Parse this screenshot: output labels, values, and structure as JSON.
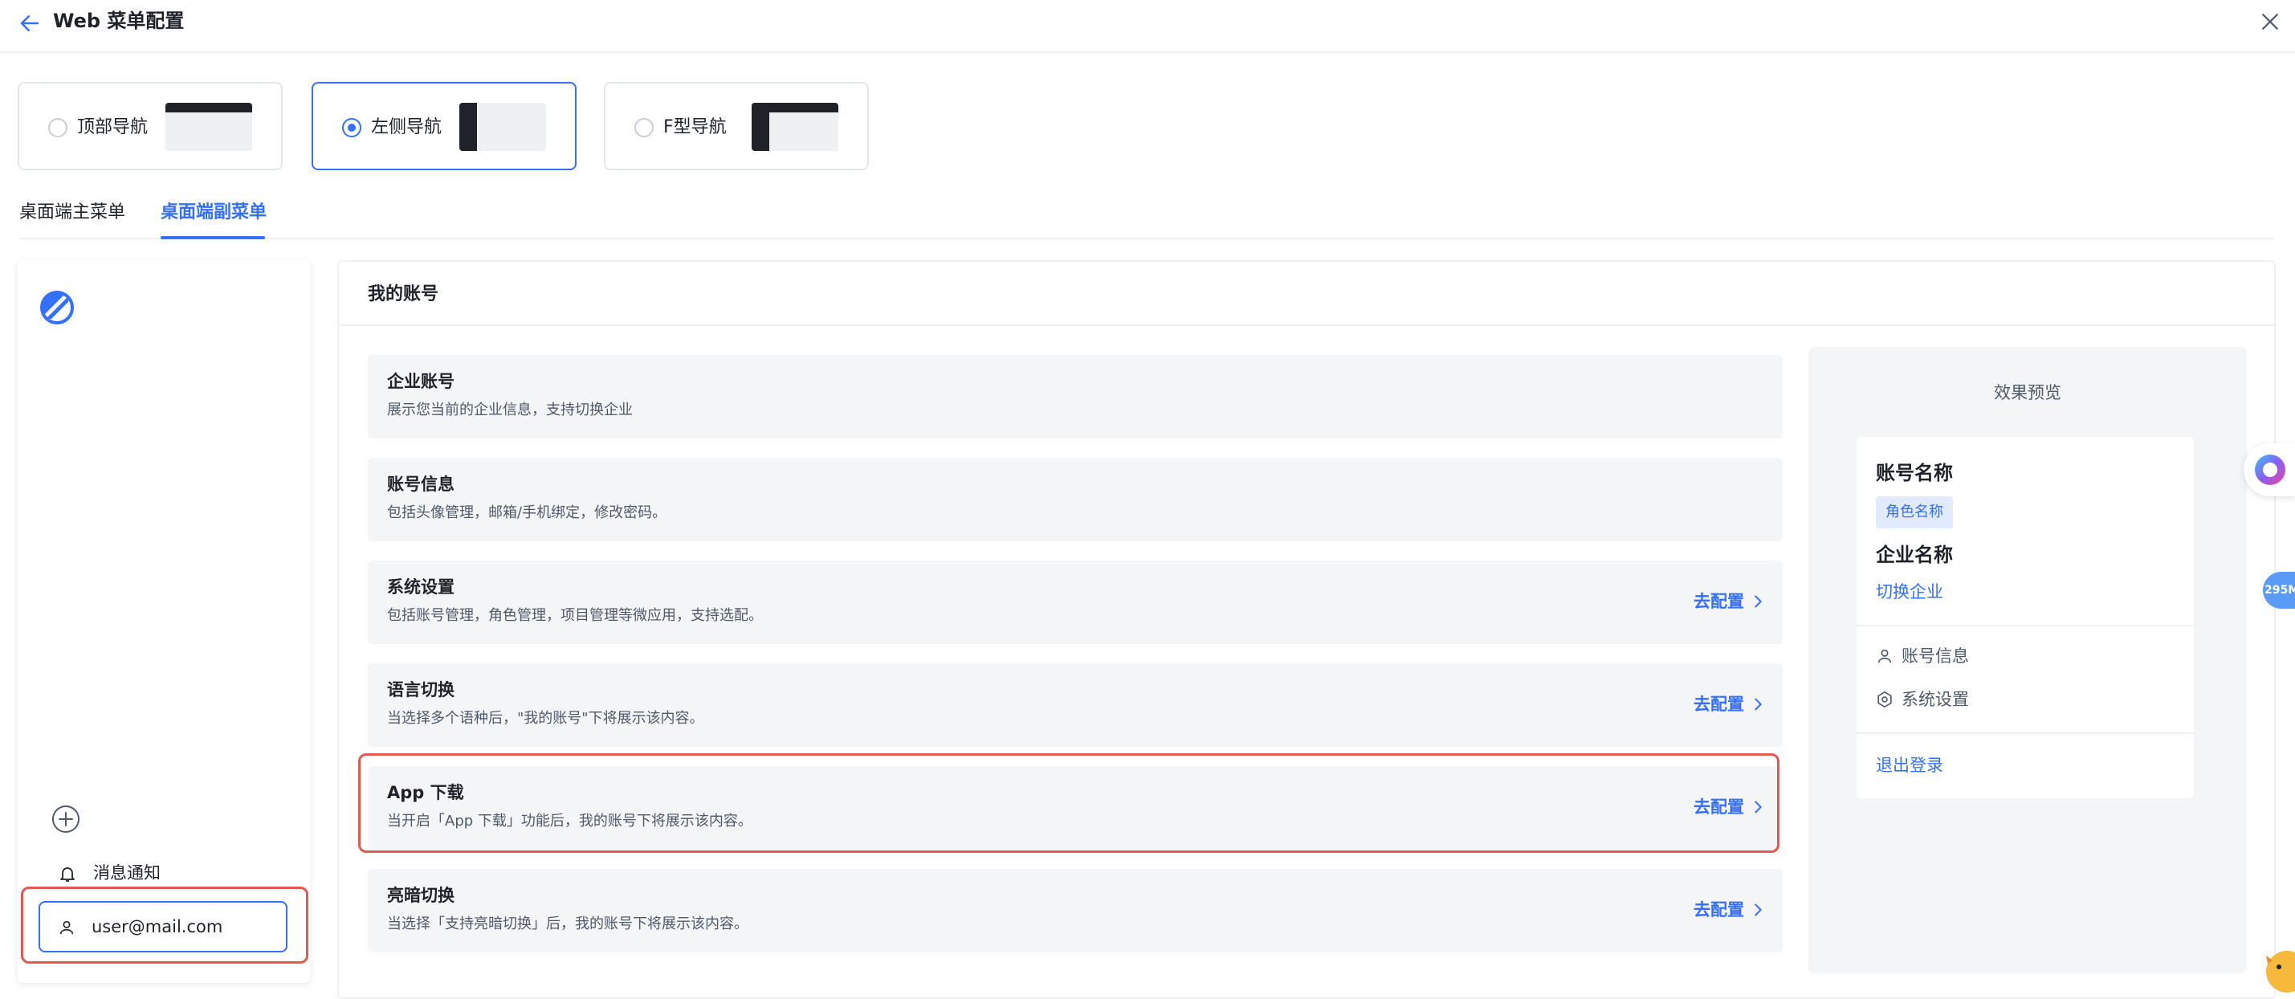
{
  "header": {
    "title": "Web 菜单配置"
  },
  "nav_layouts": [
    {
      "label": "顶部导航",
      "selected": false
    },
    {
      "label": "左侧导航",
      "selected": true
    },
    {
      "label": "F型导航",
      "selected": false
    }
  ],
  "tabs": [
    {
      "label": "桌面端主菜单",
      "active": false
    },
    {
      "label": "桌面端副菜单",
      "active": true
    }
  ],
  "menu_preview": {
    "notification_label": "消息通知",
    "user_label": "user@mail.com"
  },
  "account": {
    "title": "我的账号",
    "cards": [
      {
        "title": "企业账号",
        "desc": "展示您当前的企业信息，支持切换企业",
        "action": ""
      },
      {
        "title": "账号信息",
        "desc": "包括头像管理，邮箱/手机绑定，修改密码。",
        "action": ""
      },
      {
        "title": "系统设置",
        "desc": "包括账号管理，角色管理，项目管理等微应用，支持选配。",
        "action": "去配置"
      },
      {
        "title": "语言切换",
        "desc": "当选择多个语种后，\"我的账号\"下将展示该内容。",
        "action": "去配置"
      },
      {
        "title": "App 下载",
        "desc": "当开启「App 下载」功能后，我的账号下将展示该内容。",
        "action": "去配置"
      },
      {
        "title": "亮暗切换",
        "desc": "当选择「支持亮暗切换」后，我的账号下将展示该内容。",
        "action": "去配置"
      }
    ]
  },
  "preview": {
    "title": "效果预览",
    "account_name": "账号名称",
    "role_name": "角色名称",
    "company_name": "企业名称",
    "switch_company": "切换企业",
    "account_info": "账号信息",
    "system_settings": "系统设置",
    "logout": "退出登录"
  },
  "floating": {
    "badge_text": "295M"
  },
  "colors": {
    "accent": "#3370ff",
    "highlight": "#e5584f",
    "card_bg": "#f4f5f7"
  }
}
